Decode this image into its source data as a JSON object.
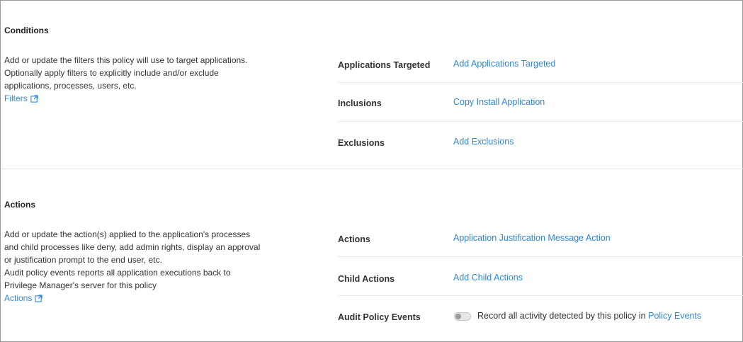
{
  "conditions": {
    "title": "Conditions",
    "description_lines": [
      "Add or update the filters this policy will use to target applications.",
      "Optionally apply filters to explicitly include and/or exclude",
      "applications, processes, users, etc."
    ],
    "link_label": "Filters",
    "rows": [
      {
        "label": "Applications Targeted",
        "value": "Add Applications Targeted"
      },
      {
        "label": "Inclusions",
        "value": "Copy Install Application"
      },
      {
        "label": "Exclusions",
        "value": "Add Exclusions"
      }
    ]
  },
  "actions": {
    "title": "Actions",
    "description_lines": [
      "Add or update the action(s) applied to the application's processes",
      "and child processes like deny, add admin rights, display an approval",
      "or justification prompt to the end user, etc.",
      "Audit policy events reports all application executions back to",
      "Privilege Manager's server for this policy"
    ],
    "link_label": "Actions",
    "rows": [
      {
        "label": "Actions",
        "value": "Application Justification Message Action"
      },
      {
        "label": "Child Actions",
        "value": "Add Child Actions"
      }
    ],
    "audit": {
      "label": "Audit Policy Events",
      "toggle_on": false,
      "text_prefix": "Record all activity detected by this policy in",
      "link_label": "Policy Events"
    }
  },
  "colors": {
    "link": "#2f86d6",
    "text": "#333333",
    "divider": "#e8e8e8",
    "frame_border": "#9a9a9a"
  },
  "icons": {
    "external_link": "external-link-icon"
  }
}
